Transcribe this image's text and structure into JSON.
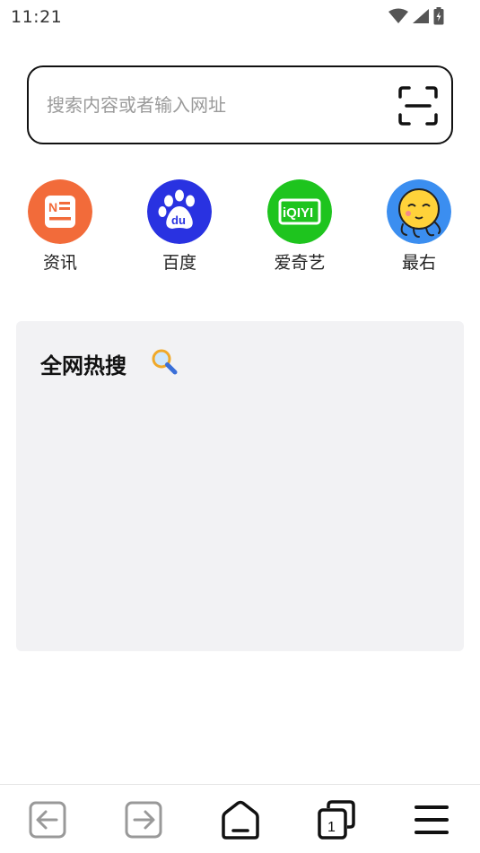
{
  "status": {
    "time": "11:21"
  },
  "search": {
    "placeholder": "搜索内容或者输入网址",
    "value": ""
  },
  "shortcuts": [
    {
      "label": "资讯",
      "icon": "news-icon",
      "color": "#f26b3a"
    },
    {
      "label": "百度",
      "icon": "baidu-icon",
      "color": "#2932e1"
    },
    {
      "label": "爱奇艺",
      "icon": "iqiyi-icon",
      "color": "#1ec41e"
    },
    {
      "label": "最右",
      "icon": "zuiyou-icon",
      "color": "#3b8ef0"
    }
  ],
  "hot_search": {
    "title": "全网热搜",
    "icon": "magnifier-emoji-icon"
  },
  "bottom_nav": {
    "tab_count": "1",
    "items": [
      "back-icon",
      "forward-icon",
      "home-icon",
      "tabs-icon",
      "menu-icon"
    ]
  }
}
